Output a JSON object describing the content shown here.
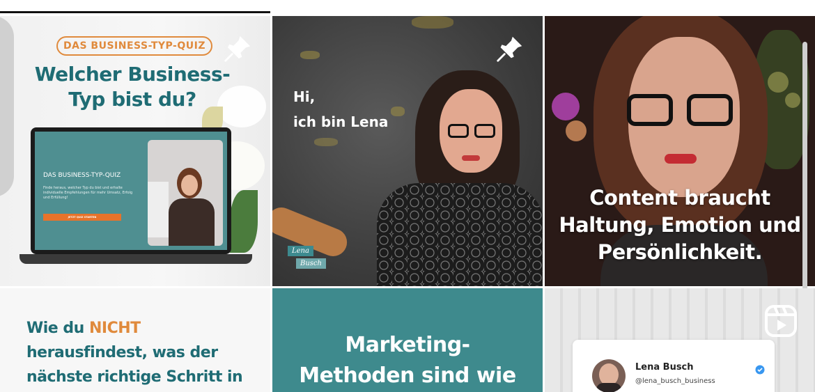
{
  "profile_grid": {
    "tiles": [
      {
        "badge": "DAS BUSINESS-TYP-QUIZ",
        "title_line1": "Welcher Business-",
        "title_line2": "Typ bist du?",
        "screen_title": "DAS BUSINESS-TYP-QUIZ",
        "screen_text": "Finde heraus, welcher Typ du bist und erhalte individuelle Empfehlungen für mehr Umsatz, Erfolg und Erfüllung!",
        "screen_button": "JETZT QUIZ STARTEN"
      },
      {
        "line1": "Hi,",
        "line2": "ich bin Lena",
        "signature_first": "Lena",
        "signature_last": "Busch"
      },
      {
        "line1": "Content braucht",
        "line2": "Haltung, Emotion und",
        "line3": "Persönlichkeit."
      },
      {
        "pre": "Wie du ",
        "highlight": "NICHT",
        "line2": "herausfindest, was der",
        "line3": "nächste richtige Schritt in"
      },
      {
        "line1": "Marketing-",
        "line2": "Methoden sind wie"
      },
      {
        "name": "Lena Busch",
        "handle": "@lena_busch_business"
      }
    ]
  },
  "icons": [
    "pin-icon",
    "reel-icon",
    "verified-icon"
  ],
  "colors": {
    "teal": "#1f6c74",
    "orange": "#e08a3c",
    "teal_bg": "#3e8a8d"
  }
}
